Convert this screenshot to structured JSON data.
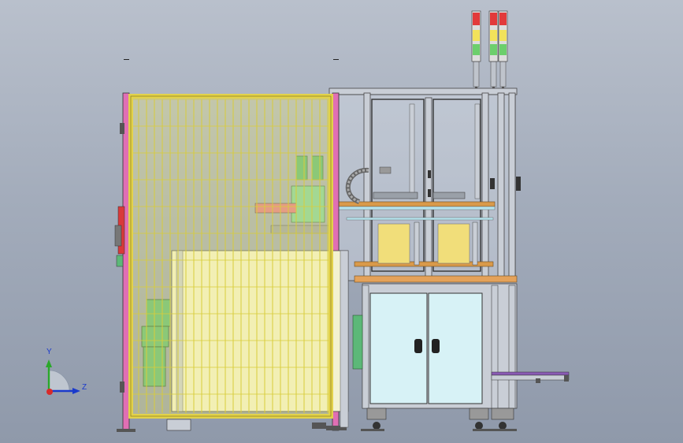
{
  "viewport": {
    "background_top": "#b9c0cc",
    "background_bottom": "#8f99aa"
  },
  "colors": {
    "guard_fence": "#f0e87a",
    "guard_mesh": "#d8cc3a",
    "frame_post": "#e06fb4",
    "aluminum_profile": "#c9ced6",
    "cabinet_panel": "#d7f2f6",
    "wood_plate": "#d99a4a",
    "motor_green": "#5cb878",
    "bracket_yellow": "#f1de7a",
    "beacon_red": "#e23a3a",
    "beacon_yellow": "#f2e25a",
    "beacon_green": "#6ccf6c",
    "tray_purple": "#8a5ab4"
  },
  "triad": {
    "y_label": "Y",
    "z_label": "Z"
  },
  "signal_towers": {
    "count": 3
  }
}
